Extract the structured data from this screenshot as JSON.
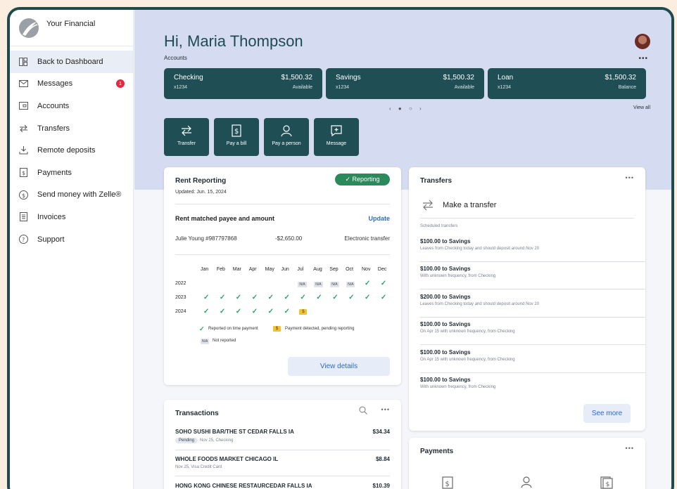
{
  "brand": {
    "name": "Your Financial"
  },
  "sidebar": {
    "items": [
      {
        "label": "Back to Dashboard",
        "icon": "dashboard-icon"
      },
      {
        "label": "Messages",
        "icon": "mail-icon",
        "badge": "1"
      },
      {
        "label": "Accounts",
        "icon": "wallet-icon"
      },
      {
        "label": "Transfers",
        "icon": "transfer-icon"
      },
      {
        "label": "Remote deposits",
        "icon": "deposit-icon"
      },
      {
        "label": "Payments",
        "icon": "bill-icon"
      },
      {
        "label": "Send money with Zelle®",
        "icon": "zelle-icon"
      },
      {
        "label": "Invoices",
        "icon": "invoice-icon"
      },
      {
        "label": "Support",
        "icon": "help-icon"
      }
    ]
  },
  "header": {
    "greeting": "Hi, Maria Thompson",
    "accounts_label": "Accounts",
    "more": "•••",
    "view_all": "View all",
    "pager": "‹ ● ○ ›"
  },
  "accounts": [
    {
      "name": "Checking",
      "number": "x1234",
      "amount": "$1,500.32",
      "status": "Available"
    },
    {
      "name": "Savings",
      "number": "x1234",
      "amount": "$1,500.32",
      "status": "Available"
    },
    {
      "name": "Loan",
      "number": "x1234",
      "amount": "$1,500.32",
      "status": "Balance"
    }
  ],
  "quick_actions": [
    {
      "label": "Transfer",
      "icon": "transfer-icon"
    },
    {
      "label": "Pay a bill",
      "icon": "bill-icon"
    },
    {
      "label": "Pay a person",
      "icon": "person-icon"
    },
    {
      "label": "Message",
      "icon": "message-icon"
    }
  ],
  "rent": {
    "title": "Rent Reporting",
    "badge": "✓  Reporting",
    "updated": "Updated: Jun. 15, 2024",
    "matched_title": "Rent matched payee and amount",
    "update_link": "Update",
    "payee": "Julie Young #987797868",
    "amount": "-$2,650.00",
    "method": "Electronic transfer",
    "months": [
      "Jan",
      "Feb",
      "Mar",
      "Apr",
      "May",
      "Jun",
      "Jul",
      "Aug",
      "Sep",
      "Oct",
      "Nov",
      "Dec"
    ],
    "years": [
      "2022",
      "2023",
      "2024"
    ],
    "grid": [
      [
        "",
        "",
        "",
        "",
        "",
        "",
        "N/A",
        "N/A",
        "N/A",
        "N/A",
        "check",
        "check"
      ],
      [
        "check",
        "check",
        "check",
        "check",
        "check",
        "check",
        "check",
        "check",
        "check",
        "check",
        "check",
        "check"
      ],
      [
        "check",
        "check",
        "check",
        "check",
        "check",
        "check",
        "pending",
        "",
        "",
        "",
        "",
        ""
      ]
    ],
    "legend_ontime": "Reported on time payment",
    "legend_pending": "Payment detected, pending reporting",
    "legend_na_tag": "N/A",
    "legend_na": "Not reported",
    "pending_glyph": "$",
    "view_details": "View details"
  },
  "transfers": {
    "title": "Transfers",
    "more": "•••",
    "make": "Make a transfer",
    "scheduled_label": "Scheduled transfers",
    "items": [
      {
        "title": "$100.00 to Savings",
        "desc": "Leaves from Checking today and should deposit around Nov 20"
      },
      {
        "title": "$100.00 to Savings",
        "desc": "With unknown frequency, from Checking"
      },
      {
        "title": "$200.00 to Savings",
        "desc": "Leaves from Checking today and should deposit around Nov 20"
      },
      {
        "title": "$100.00 to Savings",
        "desc": "On Apr 15 with unknown frequency, from Checking"
      },
      {
        "title": "$100.00 to Savings",
        "desc": "On Apr 15 with unknown frequency, from Checking"
      },
      {
        "title": "$100.00 to Savings",
        "desc": "With unknown frequency, from Checking"
      }
    ],
    "see_more": "See more"
  },
  "transactions": {
    "title": "Transactions",
    "more": "•••",
    "rows": [
      {
        "name": "SOHO SUSHI BAR/THE ST CEDAR FALLS IA",
        "amount": "$34.34",
        "pill": "Pending",
        "desc": "Nov 25, Checking"
      },
      {
        "name": "WHOLE FOODS MARKET CHICAGO IL",
        "amount": "$8.84",
        "pill": "",
        "desc": "Nov 25, Visa Credit Card"
      },
      {
        "name": "HONG KONG CHINESE RESTAURCEDAR FALLS IA",
        "amount": "$10.39",
        "pill": "",
        "desc": ""
      }
    ]
  },
  "payments": {
    "title": "Payments",
    "more": "•••"
  },
  "colors": {
    "accent": "#1f4f55",
    "hero": "#d5dcf2",
    "link": "#2c6bcd",
    "success": "#2a8a5b",
    "badge": "#e3283f"
  }
}
